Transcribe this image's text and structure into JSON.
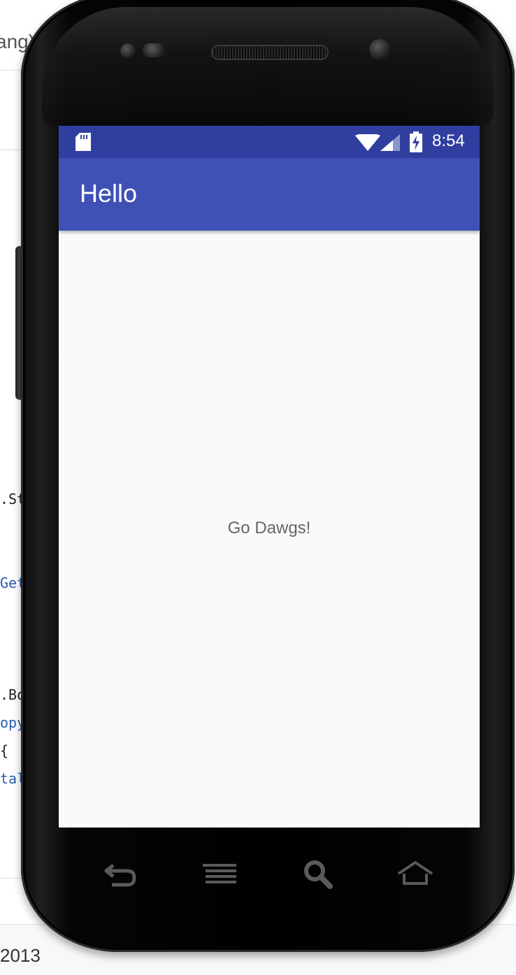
{
  "background": {
    "title_fragment": "ang)",
    "code_lines": [
      {
        "text": ".St",
        "color": "#222222"
      },
      {
        "text": "Get",
        "color": "#2a5db0"
      },
      {
        "text": ".Bo",
        "color": "#222222"
      },
      {
        "text": "opy",
        "color": "#2a5db0"
      },
      {
        "text": "{",
        "color": "#222222"
      },
      {
        "text": "tal",
        "color": "#2a5db0"
      }
    ],
    "footer_year": "2013"
  },
  "status_bar": {
    "time": "8:54",
    "color": "#303f9f",
    "icons": [
      "sd-card-icon",
      "wifi-icon",
      "signal-icon",
      "battery-charging-icon"
    ]
  },
  "app_bar": {
    "title": "Hello",
    "color": "#3f51b5"
  },
  "content": {
    "message": "Go Dawgs!"
  },
  "nav_buttons": [
    "back-icon",
    "menu-icon",
    "search-icon",
    "home-icon"
  ]
}
